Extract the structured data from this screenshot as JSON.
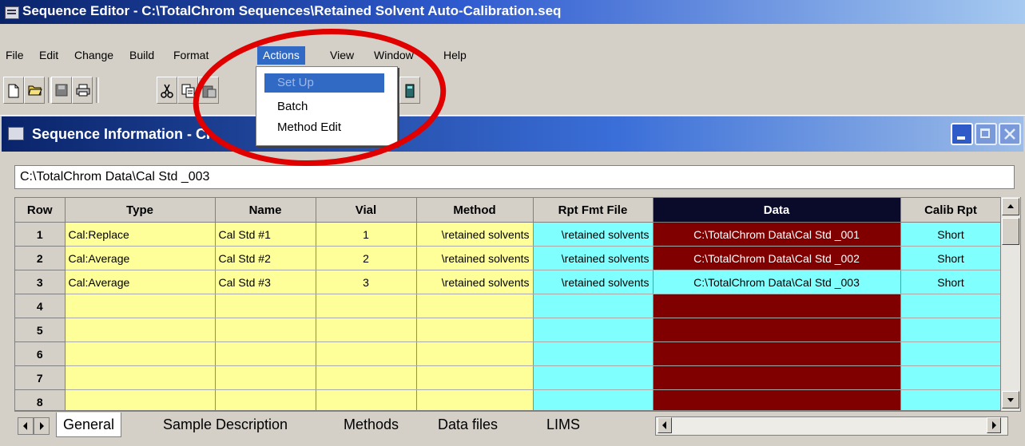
{
  "window": {
    "title": "Sequence Editor - C:\\TotalChrom Sequences\\Retained Solvent Auto-Calibration.seq"
  },
  "menubar": [
    "File",
    "Edit",
    "Change",
    "Build",
    "Format",
    "Actions",
    "View",
    "Window",
    "Help"
  ],
  "actions_menu": {
    "items": [
      "Set Up",
      "Batch",
      "Method Edit"
    ],
    "highlighted": "Set Up"
  },
  "inner_window": {
    "title": "Sequence Information - CI"
  },
  "path_field": {
    "value": "C:\\TotalChrom Data\\Cal Std _003"
  },
  "grid": {
    "columns": [
      "Row",
      "Type",
      "Name",
      "Vial",
      "Method",
      "Rpt Fmt File",
      "Data",
      "Calib Rpt"
    ],
    "rows": [
      {
        "row": "1",
        "type": "Cal:Replace",
        "name": "Cal Std #1",
        "vial": "1",
        "method": "\\retained solvents",
        "rpt": "\\retained solvents",
        "data": "C:\\TotalChrom Data\\Cal Std _001",
        "calib": "Short"
      },
      {
        "row": "2",
        "type": "Cal:Average",
        "name": "Cal Std #2",
        "vial": "2",
        "method": "\\retained solvents",
        "rpt": "\\retained solvents",
        "data": "C:\\TotalChrom Data\\Cal Std _002",
        "calib": "Short"
      },
      {
        "row": "3",
        "type": "Cal:Average",
        "name": "Cal Std #3",
        "vial": "3",
        "method": "\\retained solvents",
        "rpt": "\\retained solvents",
        "data": "C:\\TotalChrom Data\\Cal Std _003",
        "calib": "Short"
      },
      {
        "row": "4"
      },
      {
        "row": "5"
      },
      {
        "row": "6"
      },
      {
        "row": "7"
      },
      {
        "row": "8"
      }
    ]
  },
  "tabs": [
    "General",
    "Sample Description",
    "Methods",
    "Data files",
    "LIMS"
  ],
  "active_tab": "General",
  "colors": {
    "titlebar": "#0a246a",
    "menu_highlight": "#316ac5",
    "yellow_cells": "#ffff99",
    "cyan_cells": "#80ffff",
    "data_cells": "#800000",
    "annotation": "#e00000"
  }
}
